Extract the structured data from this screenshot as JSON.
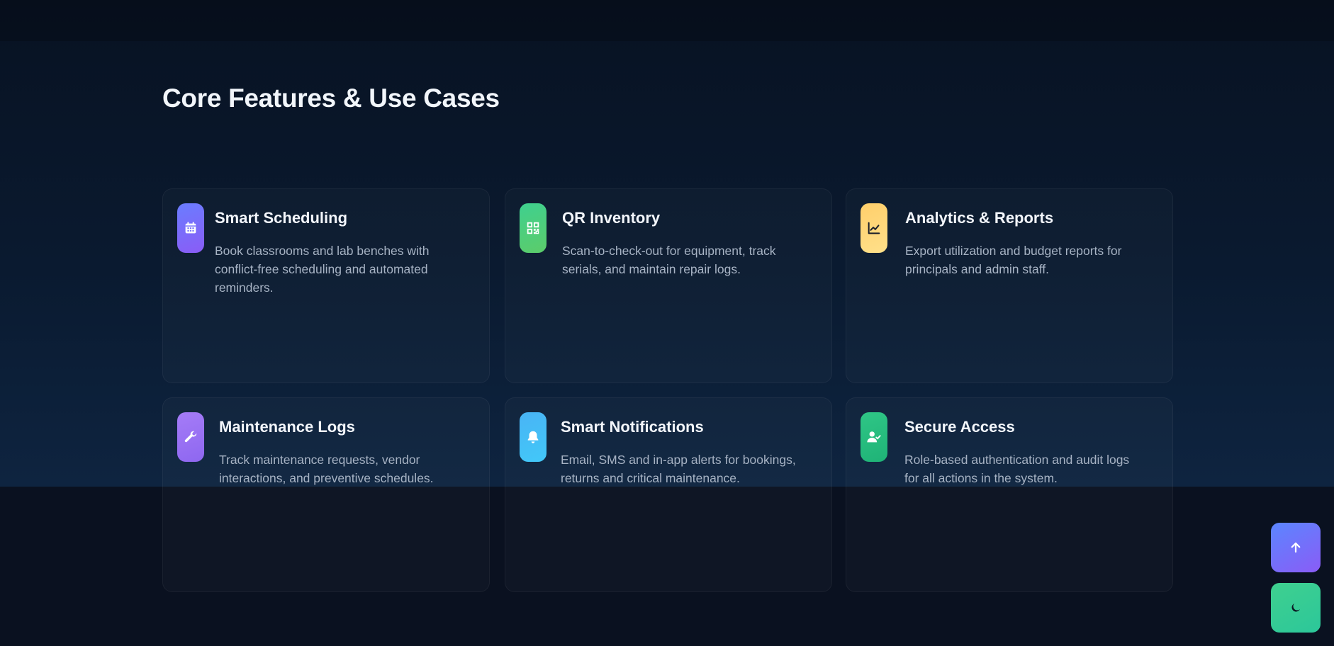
{
  "section": {
    "title": "Core Features & Use Cases"
  },
  "features": [
    {
      "title": "Smart Scheduling",
      "description": "Book classrooms and lab benches with conflict-free scheduling and automated reminders.",
      "icon": "calendar-icon",
      "gradient": [
        "#6a7dff",
        "#8a5cf6"
      ]
    },
    {
      "title": "QR Inventory",
      "description": "Scan-to-check-out for equipment, track serials, and maintain repair logs.",
      "icon": "qr-code-icon",
      "gradient": [
        "#3fd08f",
        "#5ccc6a"
      ]
    },
    {
      "title": "Analytics & Reports",
      "description": "Export utilization and budget reports for principals and admin staff.",
      "icon": "chart-line-icon",
      "gradient": [
        "#ffcf6b",
        "#ffe08a"
      ]
    },
    {
      "title": "Maintenance Logs",
      "description": "Track maintenance requests, vendor interactions, and preventive schedules.",
      "icon": "wrench-icon",
      "gradient": [
        "#a57cf7",
        "#8e67f0"
      ]
    },
    {
      "title": "Smart Notifications",
      "description": "Email, SMS and in-app alerts for bookings, returns and critical maintenance.",
      "icon": "bell-icon",
      "gradient": [
        "#49b4f5",
        "#42c8f8"
      ]
    },
    {
      "title": "Secure Access",
      "description": "Role-based authentication and audit logs for all actions in the system.",
      "icon": "user-check-icon",
      "gradient": [
        "#2fc686",
        "#1fb377"
      ]
    }
  ],
  "floating_actions": [
    {
      "name": "scroll-to-top",
      "icon": "arrow-up-icon",
      "gradient": [
        "#5b86ff",
        "#8a5cf6"
      ]
    },
    {
      "name": "theme-toggle",
      "icon": "moon-icon",
      "gradient": [
        "#3fd08f",
        "#2cc79a"
      ]
    }
  ]
}
